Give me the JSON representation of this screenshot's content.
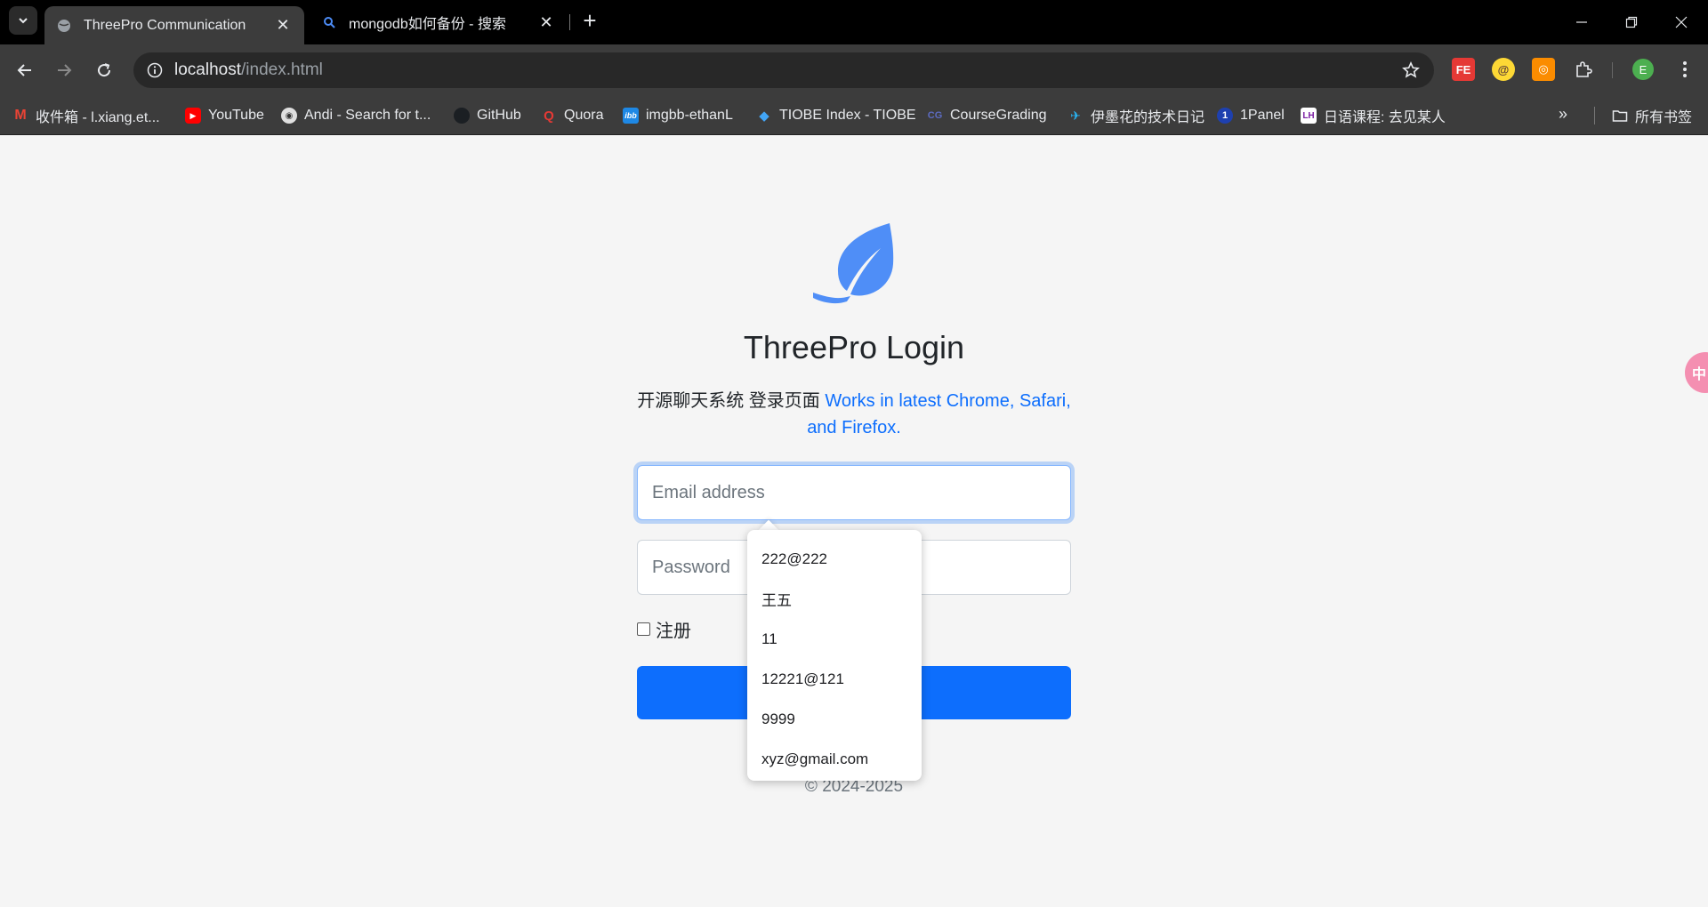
{
  "browser": {
    "tabs": [
      {
        "title": "ThreePro Communication",
        "active": true,
        "icon": "globe-icon"
      },
      {
        "title": "mongodb如何备份 - 搜索",
        "active": false,
        "icon": "search-icon"
      }
    ],
    "address_host": "localhost",
    "address_path": "/index.html",
    "profile_initial": "E",
    "extensions": [
      {
        "name": "fe-helper-extension",
        "label": "FE",
        "bg": "#e53935",
        "fg": "#ffffff"
      },
      {
        "name": "at-extension",
        "label": "@",
        "bg": "#fdd835",
        "fg": "#5d4037"
      },
      {
        "name": "orange-extension",
        "label": "◎",
        "bg": "#fb8c00",
        "fg": "#ffffff"
      }
    ],
    "bookmarks": [
      {
        "label": "收件箱 - l.xiang.et...",
        "icon": "gmail-icon",
        "bg": "#ffffff",
        "fg": "#d93025",
        "glyph": "M"
      },
      {
        "label": "YouTube",
        "icon": "youtube-icon",
        "bg": "#ff0000",
        "fg": "#ffffff",
        "glyph": "▶"
      },
      {
        "label": "Andi - Search for t...",
        "icon": "andi-icon",
        "bg": "#e0e0e0",
        "fg": "#333333",
        "glyph": "◉"
      },
      {
        "label": "GitHub",
        "icon": "github-icon",
        "bg": "#24292e",
        "fg": "#ffffff",
        "glyph": "●"
      },
      {
        "label": "Quora",
        "icon": "quora-icon",
        "bg": "#3c3c3c",
        "fg": "#b92b27",
        "glyph": "Q"
      },
      {
        "label": "imgbb-ethanL",
        "icon": "imgbb-icon",
        "bg": "#1e88e5",
        "fg": "#ffffff",
        "glyph": "ibb"
      },
      {
        "label": "TIOBE Index - TIOBE",
        "icon": "tiobe-icon",
        "bg": "#1565c0",
        "fg": "#ffffff",
        "glyph": "◆"
      },
      {
        "label": "CourseGrading",
        "icon": "coursegrading-icon",
        "bg": "#3c3c3c",
        "fg": "#42a5f5",
        "glyph": "CG"
      },
      {
        "label": "伊墨花的技术日记",
        "icon": "blog-icon",
        "bg": "#3c3c3c",
        "fg": "#29b6f6",
        "glyph": "✈"
      },
      {
        "label": "1Panel",
        "icon": "1panel-icon",
        "bg": "#1e40af",
        "fg": "#ffffff",
        "glyph": "1"
      },
      {
        "label": "日语课程: 去见某人",
        "icon": "lh-icon",
        "bg": "#ffffff",
        "fg": "#7b1fa2",
        "glyph": "LH"
      }
    ],
    "all_bookmarks_label": "所有书签"
  },
  "login": {
    "heading": "ThreePro Login",
    "lead_plain": "开源聊天系统 登录页面 ",
    "lead_link": "Works in latest Chrome, Safari, and Firefox.",
    "email_placeholder": "Email address",
    "password_placeholder": "Password",
    "register_label": "注册",
    "copyright": "© 2024-2025",
    "accent_color": "#0d6efd",
    "logo_color": "#4f8ef7"
  },
  "autocomplete": {
    "items": [
      "222@222",
      "王五",
      "11",
      "12221@121",
      "9999",
      "xyz@gmail.com"
    ]
  },
  "side_widget": {
    "label": "中"
  }
}
